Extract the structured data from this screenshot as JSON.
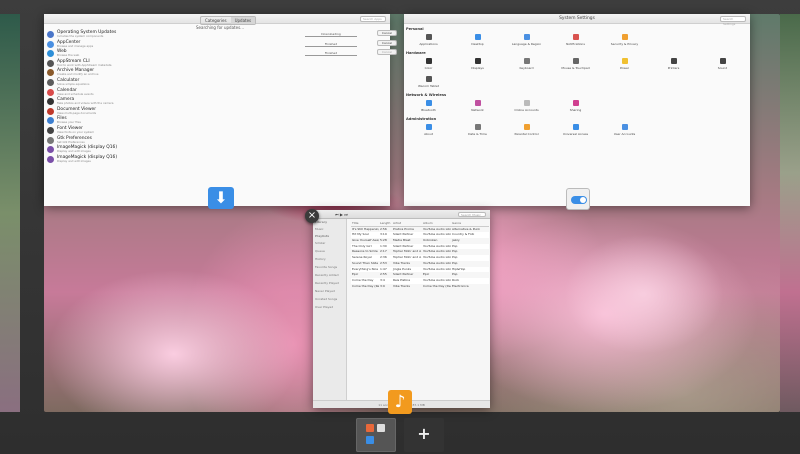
{
  "appcenter": {
    "tabs": [
      "Categories",
      "Updates"
    ],
    "active_tab": "Updates",
    "search_placeholder": "Search Apps",
    "status": "Searching for updates…",
    "items": [
      {
        "name": "Operating System Updates",
        "desc": "Includes the system components",
        "icon_color": "#4a76c9",
        "progress": "Downloading",
        "button": "Cancel",
        "button_dim": false
      },
      {
        "name": "AppCenter",
        "desc": "Browse and manage apps",
        "icon_color": "#4a90e2",
        "progress": "Finished",
        "button": "Cancel",
        "button_dim": false
      },
      {
        "name": "Web",
        "desc": "Browse the web",
        "icon_color": "#2d8fd8",
        "progress": "Finished",
        "button": "Cancel",
        "button_dim": true
      },
      {
        "name": "AppStream CLI",
        "desc": "Tool to work with AppStream metadata",
        "icon_color": "#555555"
      },
      {
        "name": "Archive Manager",
        "desc": "Create and modify an archive",
        "icon_color": "#8a5a2b"
      },
      {
        "name": "Calculator",
        "desc": "Solve simple equations",
        "icon_color": "#5c5c5c"
      },
      {
        "name": "Calendar",
        "desc": "View and schedule events",
        "icon_color": "#d94b4b"
      },
      {
        "name": "Camera",
        "desc": "Take photos and videos with the camera",
        "icon_color": "#333333"
      },
      {
        "name": "Document Viewer",
        "desc": "View multi-page documents",
        "icon_color": "#c0392b"
      },
      {
        "name": "Files",
        "desc": "Browse your files",
        "icon_color": "#3d7fd0"
      },
      {
        "name": "Font Viewer",
        "desc": "View fonts on your system",
        "icon_color": "#444444"
      },
      {
        "name": "Gtk Preferences",
        "desc": "Set Gtk Preferences",
        "icon_color": "#777777"
      },
      {
        "name": "ImageMagick (display Q16)",
        "desc": "Display and edit images",
        "icon_color": "#7a4fa8"
      },
      {
        "name": "ImageMagick (display Q16)",
        "desc": "Display and edit images",
        "icon_color": "#7a4fa8"
      }
    ]
  },
  "settings": {
    "title": "System Settings",
    "search_placeholder": "Search Settings",
    "categories": [
      {
        "name": "Personal",
        "items": [
          {
            "label": "Applications",
            "color": "#555555"
          },
          {
            "label": "Desktop",
            "color": "#3a8ee6"
          },
          {
            "label": "Language & Region",
            "color": "#4a90e2"
          },
          {
            "label": "Notifications",
            "color": "#d9534f"
          },
          {
            "label": "Security & Privacy",
            "color": "#f0a030"
          }
        ]
      },
      {
        "name": "Hardware",
        "items": [
          {
            "label": "Color",
            "color": "#333333"
          },
          {
            "label": "Displays",
            "color": "#333333"
          },
          {
            "label": "Keyboard",
            "color": "#777777"
          },
          {
            "label": "Mouse & Touchpad",
            "color": "#666666"
          },
          {
            "label": "Power",
            "color": "#f0c030"
          },
          {
            "label": "Printers",
            "color": "#444444"
          },
          {
            "label": "Sound",
            "color": "#444444"
          },
          {
            "label": "Wacom Tablet",
            "color": "#555555"
          }
        ]
      },
      {
        "name": "Network & Wireless",
        "items": [
          {
            "label": "Bluetooth",
            "color": "#3a8ee6"
          },
          {
            "label": "Network",
            "color": "#c050a0"
          },
          {
            "label": "Online Accounts",
            "color": "#bbbbbb"
          },
          {
            "label": "Sharing",
            "color": "#d04090"
          }
        ]
      },
      {
        "name": "Administration",
        "items": [
          {
            "label": "About",
            "color": "#3a8ee6"
          },
          {
            "label": "Date & Time",
            "color": "#777777"
          },
          {
            "label": "Parental Control",
            "color": "#f0a030"
          },
          {
            "label": "Universal Access",
            "color": "#3a8ee6"
          },
          {
            "label": "User Accounts",
            "color": "#4a90e2"
          }
        ]
      }
    ]
  },
  "music": {
    "search_placeholder": "Search Music",
    "controls": "⏮ ▶ ⏭",
    "sidebar": {
      "library_header": "Library",
      "library_items": [
        "Music"
      ],
      "playlists_header": "Playlists",
      "playlists": [
        "Similar",
        "Queue",
        "History",
        "Favorite Songs",
        "Recently Added",
        "Recently Played",
        "Never Played",
        "Unrated Songs",
        "Over Played"
      ]
    },
    "columns": [
      "Title",
      "Length",
      "Artist",
      "Album",
      "Genre"
    ],
    "rows": [
      [
        "It's Still Happening",
        "2:56",
        "Pratica Proma",
        "YouTube Audio Libr",
        "Alternative & Punk"
      ],
      [
        "Hit My Soul",
        "3:19",
        "Silent Partner",
        "YouTube Audio Libr",
        "Country & Folk"
      ],
      [
        "Give Yourself Away",
        "5:28",
        "Media Blast",
        "Unbroken",
        "jazzy"
      ],
      [
        "The Only Girl",
        "1:30",
        "Silent Partner",
        "YouTube Audio Libr",
        "Pop"
      ],
      [
        "Reasons to Smile",
        "2:17",
        "Topher Mohr and A",
        "YouTube Audio Libr",
        "Pop"
      ],
      [
        "Serene Royal",
        "2:36",
        "Topher Mohr and A",
        "YouTube Audio Libr",
        "Pop"
      ],
      [
        "Sound Then Slide",
        "2:53",
        "Vibe Tracks",
        "YouTube Audio Libr",
        "Pop"
      ],
      [
        "Everything's Nice",
        "1:47",
        "Jingle Punks",
        "YouTube Audio Libr",
        "Hip&Hop"
      ],
      [
        "Epic",
        "2:55",
        "Silent Partner",
        "Epic",
        "Pop"
      ],
      [
        "Come the Day",
        "3:4",
        "Reis Pistina",
        "YouTube Audio Libr",
        "Rock"
      ],
      [
        "Come the Day (Ree)",
        "3:9",
        "Vibe Tracks",
        "Come the Day (Deg",
        "Electronica"
      ]
    ],
    "footer": "11 songs, 30 minutes, 87.1 MB"
  },
  "switcher": {
    "add_label": "+"
  },
  "colors": {
    "accent": "#3a8ee6",
    "music_badge": "#f29a1e"
  }
}
